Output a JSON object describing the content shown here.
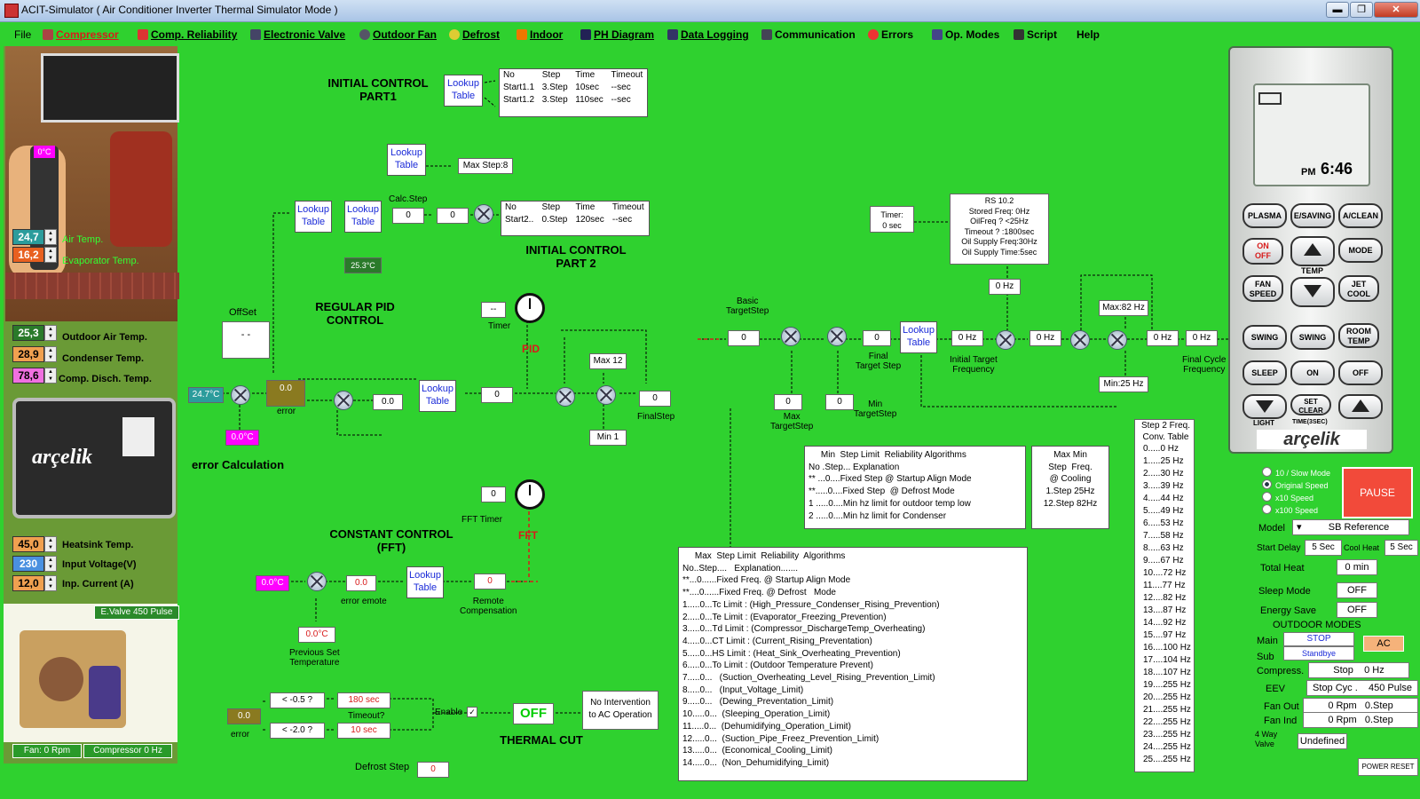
{
  "window": {
    "title": "ACIT-Simulator      ( Air Conditioner Inverter Thermal Simulator  Mode )",
    "btn_min": "▬",
    "btn_max": "❐",
    "btn_close": "✕"
  },
  "menu": [
    {
      "label": "File",
      "color": ""
    },
    {
      "label": "Compressor",
      "color": "#d81b1b"
    },
    {
      "label": "Comp. Reliability",
      "color": ""
    },
    {
      "label": "Electronic  Valve",
      "color": ""
    },
    {
      "label": "Outdoor Fan",
      "color": ""
    },
    {
      "label": "Defrost",
      "color": ""
    },
    {
      "label": "Indoor",
      "color": ""
    },
    {
      "label": "PH Diagram",
      "color": ""
    },
    {
      "label": "Data Logging",
      "color": ""
    },
    {
      "label": "Communication",
      "color": ""
    },
    {
      "label": "Errors",
      "color": ""
    },
    {
      "label": "Op. Modes",
      "color": ""
    },
    {
      "label": "Script",
      "color": ""
    },
    {
      "label": "Help",
      "color": ""
    }
  ],
  "left": {
    "remote_temp": "0°C",
    "air_temp": {
      "value": "24,7",
      "label": "Air Temp."
    },
    "evap_temp": {
      "value": "16,2",
      "label": "Evaporator Temp."
    },
    "outdoor_air": {
      "value": "25,3",
      "label": "Outdoor Air Temp."
    },
    "condenser": {
      "value": "28,9",
      "label": "Condenser Temp."
    },
    "comp_disch": {
      "value": "78,6",
      "label": "Comp. Disch. Temp."
    },
    "brand": "arçelik",
    "heatsink": {
      "value": "45,0",
      "label": "Heatsink Temp."
    },
    "input_voltage": {
      "value": "230",
      "label": "Input Voltage(V)"
    },
    "inp_current": {
      "value": "12,0",
      "label": "Inp. Current (A)"
    },
    "evalve": "E.Valve 450 Pulse",
    "fan": "Fan: 0 Rpm",
    "compressor": "Compressor 0 Hz"
  },
  "diagram": {
    "ic1_title": "INITIAL CONTROL\nPART1",
    "lookup": "Lookup\nTable",
    "ic1_table": [
      [
        "No",
        "Step",
        "Time",
        "Timeout"
      ],
      [
        "Start1.1",
        "3.Step",
        "10sec",
        "--sec"
      ],
      [
        "Start1.2",
        "3.Step",
        "110sec",
        "--sec"
      ]
    ],
    "max_step": "Max Step:8",
    "calc_step_label": "Calc.Step",
    "calc_step": "0",
    "calc_step2": "0",
    "ic2_table": [
      [
        "No",
        "Step",
        "Time",
        "Timeout"
      ],
      [
        "Start2..",
        "0.Step",
        "120sec",
        "--sec"
      ]
    ],
    "ic2_title": "INITIAL CONTROL\nPART 2",
    "temp_253": "25.3°C",
    "offset_label": "OffSet",
    "offset_value": "- -",
    "pid_title": "REGULAR PID\nCONTROL",
    "timer_value": "--",
    "timer_label": "Timer",
    "pid_label": "PID",
    "temp_247": "24.7°C",
    "error_value": "0.0",
    "error_label": "error",
    "val_00": "0.0",
    "val_0": "0",
    "max12": "Max 12",
    "min1": "Min 1",
    "final_step_label": "FinalStep",
    "final_step": "0",
    "temp_00": "0.0°C",
    "err_calc": "error Calculation",
    "fft_timer_value": "0",
    "fft_timer_label": "FFT Timer",
    "fft_label": "FFT",
    "cc_title": "CONSTANT CONTROL\n(FFT)",
    "cc_temp": "0.0°C",
    "cc_err": "0.0",
    "cc_err_label": "error emote",
    "remote_comp_label": "Remote\nCompensation",
    "remote_comp": "0",
    "prev_set": "0.0°C",
    "prev_set_label": "Previous Set\nTemperature",
    "tc_error": "0.0",
    "tc_error_label": "error",
    "cond1": "< -0.5 ?",
    "cond2": "< -2.0 ?",
    "t180": "180 sec",
    "timeout_label": "Timeout?",
    "t10": "10 sec",
    "enable": "Enable",
    "off": "OFF",
    "no_interv": "No Intervention\nto AC Operation",
    "thermal_cut": "THERMAL CUT",
    "defrost_step_label": "Defrost Step",
    "defrost_step": "0",
    "timer2": "Timer:\n0 sec",
    "rs": "RS 10.2\nStored Freq: 0Hz\nOilFreq ? <25Hz\nTimeout ? :1800sec\nOil Supply Freq:30Hz\nOil Supply Time:5sec",
    "basic_ts_label": "Basic\nTargetStep",
    "basic_ts": "0",
    "fts": "0",
    "fts_label": "Final\nTarget Step",
    "max_ts": "0",
    "max_ts_label": "Max\nTargetStep",
    "min_ts": "0",
    "min_ts_label": "Min\nTargetStep",
    "hz1": "0 Hz",
    "hz2": "0 Hz",
    "hz3": "0 Hz",
    "hz4": "0 Hz",
    "hz5": "0 Hz",
    "hz6": "0 Hz",
    "init_target_label": "Initial Target\nFrequency",
    "max82": "Max:82 Hz",
    "min25": "Min:25 Hz",
    "final_cycle_label": "Final Cycle\nFrequency",
    "min_step_panel": "     Min  Step Limit  Reliability Algorithms\nNo .Step... Explanation\n** ...0....Fixed Step @ Startup Align Mode\n**.....0....Fixed Step  @ Defrost Mode\n1 .....0....Min hz limit for outdoor temp low\n2 .....0....Min hz limit for Condenser",
    "maxmin_panel": "Max Min\nStep  Freq.\n@ Cooling\n1.Step 25Hz\n12.Step 82Hz",
    "max_step_panel": "     Max  Step Limit  Reliability  Algorithms\nNo..Step....   Explanation.......\n**...0......Fixed Freq. @ Startup Align Mode\n**....0......Fixed Freq. @ Defrost   Mode\n1.....0...Tc Limit : (High_Pressure_Condenser_Rising_Prevention)\n2.....0...Te Limit : (Evaporator_Freezing_Prevention)\n3.....0...Td Limit : (Compressor_DischargeTemp_Overheating)\n4.....0...CT Limit : (Current_Rising_Preventation)\n5.....0...HS Limit : (Heat_Sink_Overheating_Prevention)\n6.....0...To Limit : (Outdoor Temperature Prevent)\n7.....0...   (Suction_Overheating_Level_Rising_Prevention_Limit)\n8.....0...   (Input_Voltage_Limit)\n9.....0...   (Dewing_Preventation_Limit)\n10.....0...  (Sleeping_Operation_Limit)\n11.....0...  (Dehumidifying_Operation_Limit)\n12.....0...  (Suction_Pipe_Freez_Prevention_Limit)\n13.....0...  (Economical_Cooling_Limit)\n14.....0...  (Non_Dehumidifying_Limit)",
    "step2_title": "Step 2 Freq.\nConv. Table",
    "step2": [
      "0.....0 Hz",
      "1.....25 Hz",
      "2.....30 Hz",
      "3.....39 Hz",
      "4.....44 Hz",
      "5.....49 Hz",
      "6.....53 Hz",
      "7.....58 Hz",
      "8.....63 Hz",
      "9.....67 Hz",
      "10....72 Hz",
      "11....77 Hz",
      "12....82 Hz",
      "13....87 Hz",
      "14....92 Hz",
      "15....97 Hz",
      "16....100 Hz",
      "17....104 Hz",
      "18....107 Hz",
      "19....255 Hz",
      "20....255 Hz",
      "21....255 Hz",
      "22....255 Hz",
      "23....255 Hz",
      "24....255 Hz",
      "25....255 Hz"
    ]
  },
  "remote": {
    "pm": "PM",
    "time": "6:46",
    "btn": {
      "plasma": "PLASMA",
      "esaving": "E/SAVING",
      "aclean": "A/CLEAN",
      "onoff_on": "ON",
      "onoff_off": "OFF",
      "temp": "TEMP",
      "mode": "MODE",
      "fan1": "FAN",
      "fan2": "SPEED",
      "jet1": "JET",
      "jet2": "COOL",
      "swing1": "SWING",
      "swing2": "SWING",
      "room1": "ROOM",
      "room2": "TEMP",
      "sleep": "SLEEP",
      "on": "ON",
      "off": "OFF",
      "light": "LIGHT",
      "set1": "SET",
      "set2": "CLEAR",
      "timer3": "TIME(3SEC)"
    },
    "brand": "arçelik"
  },
  "controls": {
    "speeds": [
      "10 / Slow Mode",
      "Original Speed",
      "x10 Speed",
      "x100 Speed"
    ],
    "pause": "PAUSE",
    "model_label": "Model",
    "model_value": "SB Reference",
    "start_delay_label": "Start Delay",
    "start_delay": "5 Sec",
    "cool_heat_label": "Cool Heat",
    "cool_heat": "5 Sec",
    "total_heat_label": "Total Heat",
    "total_heat": "0 min",
    "sleep_mode_label": "Sleep Mode",
    "sleep_mode": "OFF",
    "energy_save_label": "Energy Save",
    "energy_save": "OFF",
    "outdoor_modes": "OUTDOOR MODES",
    "main_label": "Main",
    "main_value": "STOP",
    "sub_label": "Sub",
    "sub_value": "Standbye",
    "ac": "AC",
    "compress_label": "Compress.",
    "compress": "Stop    0 Hz",
    "eev_label": "EEV",
    "eev": "Stop Cyc .    450 Pulse",
    "fan_out_label": "Fan Out",
    "fan_out": "0 Rpm   0.Step",
    "fan_ind_label": "Fan Ind",
    "fan_ind": "0 Rpm   0.Step",
    "way_label": "4 Way\nValve",
    "way_value": "Undefined",
    "power_reset": "POWER RESET"
  }
}
